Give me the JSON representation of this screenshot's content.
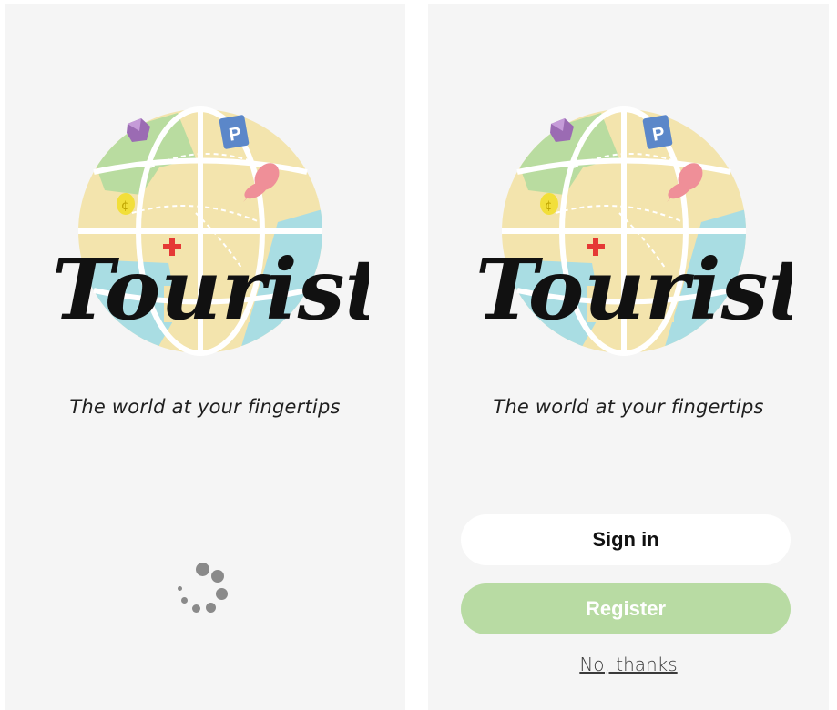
{
  "app": {
    "name": "Tourista",
    "tagline": "The world at your fingertips"
  },
  "loading_screen": {
    "spinner": "loading-spinner-icon"
  },
  "auth_screen": {
    "sign_in_label": "Sign in",
    "register_label": "Register",
    "skip_label": "No, thanks"
  },
  "colors": {
    "background": "#f5f5f5",
    "register_button": "#b8dba3",
    "sign_in_button": "#ffffff",
    "map_land": "#f3e4ad",
    "map_water": "#a9dde3",
    "map_park": "#b9dca0",
    "pin": "#ef8f98",
    "parking_sign": "#5b87c9",
    "cross": "#e53935",
    "coin": "#f2df3a",
    "gem": "#9b6bb3"
  },
  "icons": [
    "globe-map-icon",
    "parking-sign-icon",
    "map-pin-icon",
    "coin-icon",
    "gem-icon",
    "medical-cross-icon"
  ]
}
